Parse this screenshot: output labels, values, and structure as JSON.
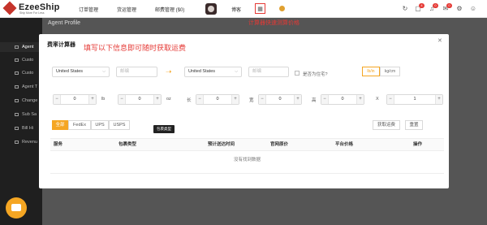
{
  "brand": {
    "name": "EzeeShip",
    "tagline": "Ship More For Less"
  },
  "nav": {
    "items": [
      "订单管理",
      "货运管理",
      "邮费管理 ($0)",
      "博客"
    ],
    "calculator_icon": "calculator-icon",
    "toolbar_icons": [
      "refresh-icon",
      "document-icon",
      "bell-icon",
      "mail-icon",
      "gear-icon",
      "user-icon"
    ],
    "badges": [
      "4",
      "0",
      "0"
    ]
  },
  "annotations": {
    "top": "计算器快速测算价格",
    "modal": "填写以下信息即可随时获取运费"
  },
  "page": {
    "title": "Agent Profile"
  },
  "sidebar": {
    "items": [
      "Agent",
      "Custo",
      "Custo",
      "Agent T",
      "Change",
      "Sub Sa",
      "Bill Hi",
      "Revenu"
    ]
  },
  "modal": {
    "title": "费率计算器",
    "close_icon": "close-icon",
    "from_country": "United States",
    "from_zip_placeholder": "邮编",
    "to_country": "United States",
    "to_zip_placeholder": "邮编",
    "residential_label": "是否为住宅?",
    "unit_options": [
      "lb/in",
      "kg/cm"
    ],
    "weight": {
      "lb": "0",
      "lb_unit": "lb",
      "oz": "0",
      "oz_unit": "oz"
    },
    "dims": [
      {
        "label": "长",
        "value": "0"
      },
      {
        "label": "宽",
        "value": "0"
      },
      {
        "label": "高",
        "value": "0"
      }
    ],
    "qty": {
      "label": "X",
      "value": "1"
    },
    "carriers": [
      "全部",
      "FedEx",
      "UPS",
      "USPS"
    ],
    "tooltip": "包裹类型",
    "buttons": {
      "get_rates": "获取运费",
      "reset": "重置"
    },
    "table": {
      "headers": [
        "服务",
        "包裹类型",
        "预计送达时间",
        "官网原价",
        "平台价格",
        "操作"
      ],
      "empty": "没有找到数据"
    }
  },
  "colors": {
    "accent": "#f5a623",
    "annotation": "#e53935",
    "brand": "#c5342b"
  }
}
